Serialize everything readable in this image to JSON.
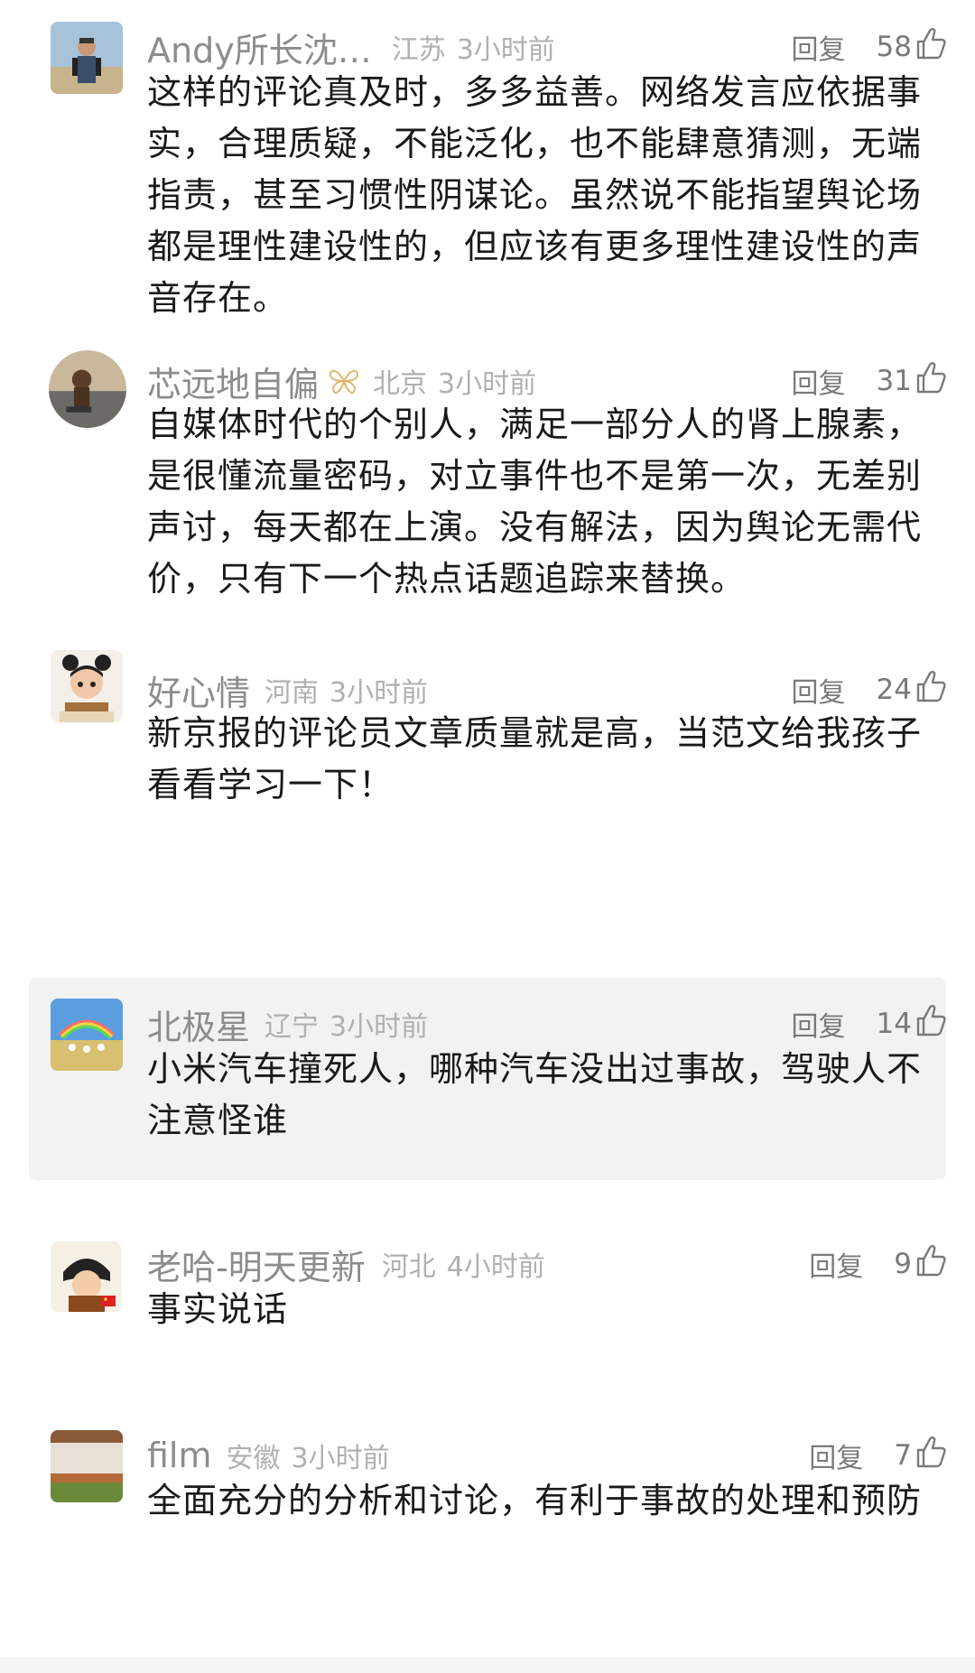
{
  "labels": {
    "reply": "回复"
  },
  "comments": [
    {
      "name": "Andy所长沈…",
      "location": "江苏",
      "time": "3小时前",
      "likes": "58",
      "text": "这样的评论真及时，多多益善。网络发言应依据事实，合理质疑，不能泛化，也不能肆意猜测，无端指责，甚至习惯性阴谋论。虽然说不能指望舆论场都是理性建设性的，但应该有更多理性建设性的声音存在。",
      "avatar": "man-outdoors-photo"
    },
    {
      "name": "芯远地自偏",
      "location": "北京",
      "time": "3小时前",
      "likes": "31",
      "text": "自媒体时代的个别人，满足一部分人的肾上腺素，是很懂流量密码，对立事件也不是第一次，无差别声讨，每天都在上演。没有解法，因为舆论无需代价，只有下一个热点话题追踪来替换。",
      "avatar": "monkey-road-photo",
      "badge": "butterfly-badge-icon"
    },
    {
      "name": "好心情",
      "location": "河南",
      "time": "3小时前",
      "likes": "24",
      "text": "新京报的评论员文章质量就是高，当范文给我孩子看看学习一下！",
      "avatar": "cartoon-girl-avatar"
    },
    {
      "name": "北极星",
      "location": "辽宁",
      "time": "3小时前",
      "likes": "14",
      "text": "小米汽车撞死人，哪种汽车没出过事故，驾驶人不注意怪谁",
      "avatar": "children-field-photo",
      "highlighted": true
    },
    {
      "name": "老哈-明天更新",
      "location": "河北",
      "time": "4小时前",
      "likes": "9",
      "text": "事实说话",
      "avatar": "cartoon-boy-avatar"
    },
    {
      "name": "film",
      "location": "安徽",
      "time": "3小时前",
      "likes": "7",
      "text": "全面充分的分析和讨论，有利于事故的处理和预防",
      "avatar": "landscape-photo"
    }
  ],
  "colors": {
    "name": "#8c8c8c",
    "meta": "#b0b0b0",
    "text": "#1a1a1a",
    "highlight_bg": "#f2f2f2"
  }
}
